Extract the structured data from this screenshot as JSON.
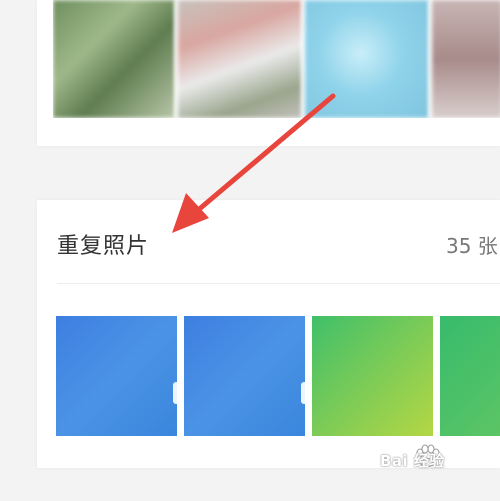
{
  "duplicate_section": {
    "title": "重复照片",
    "count": "35 张"
  },
  "watermark": {
    "text": "Bai 经验"
  },
  "colors": {
    "arrow": "#e8453c",
    "card": "#ffffff",
    "background": "#f3f3f3"
  }
}
